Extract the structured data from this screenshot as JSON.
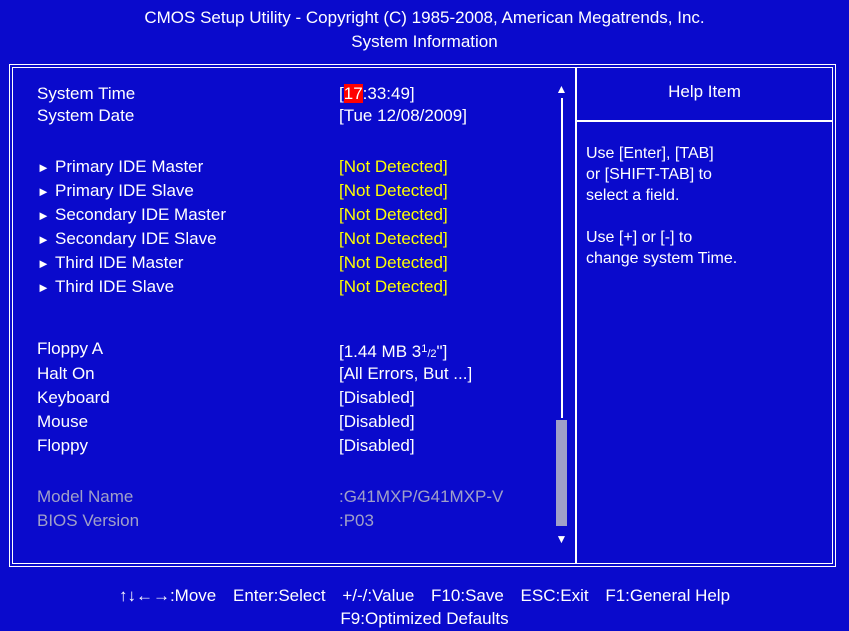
{
  "header": {
    "line1": "CMOS Setup Utility - Copyright (C) 1985-2008, American Megatrends, Inc.",
    "line2": "System Information"
  },
  "system_time": {
    "label": "System Time",
    "open": "[",
    "hour": "17",
    "rest": ":33:49]"
  },
  "system_date": {
    "label": "System Date",
    "value": "[Tue 12/08/2009]"
  },
  "ide": [
    {
      "label": "Primary IDE Master",
      "value": "[Not Detected]"
    },
    {
      "label": "Primary IDE Slave",
      "value": "[Not Detected]"
    },
    {
      "label": "Secondary IDE Master",
      "value": "[Not Detected]"
    },
    {
      "label": "Secondary IDE Slave",
      "value": "[Not Detected]"
    },
    {
      "label": "Third IDE Master",
      "value": "[Not Detected]"
    },
    {
      "label": "Third IDE Slave",
      "value": "[Not Detected]"
    }
  ],
  "devices": {
    "floppy_a": {
      "label": "Floppy A",
      "value_pre": "[1.44 MB 3",
      "value_sup": "1",
      "value_slash": "/",
      "value_sub": "2",
      "value_post": "\"]"
    },
    "halt_on": {
      "label": "Halt On",
      "value": "[All Errors, But ...]"
    },
    "keyboard": {
      "label": "Keyboard",
      "value": "[Disabled]"
    },
    "mouse": {
      "label": "Mouse",
      "value": "[Disabled]"
    },
    "floppy": {
      "label": "Floppy",
      "value": "[Disabled]"
    }
  },
  "info": {
    "model_label": "Model Name",
    "model_value": ":G41MXP/G41MXP-V",
    "bios_label": "BIOS Version",
    "bios_value": ":P03"
  },
  "help": {
    "title": "Help Item",
    "p1": "Use [Enter], [TAB]\nor [SHIFT-TAB] to\nselect a field.",
    "p2": "Use [+] or [-] to\nchange system Time."
  },
  "scrollbar": {
    "up_icon": "triangle-up",
    "down_icon": "triangle-down"
  },
  "footer": {
    "move": "↑↓←→:Move",
    "select": "Enter:Select",
    "value": "+/-/:Value",
    "save": "F10:Save",
    "exit": "ESC:Exit",
    "help": "F1:General Help",
    "defaults": "F9:Optimized Defaults"
  },
  "colors": {
    "background": "#0a0acc",
    "text": "#ffffff",
    "highlight_value": "#ffff00",
    "disabled_text": "#a0a0c8",
    "cursor": "#ff0000"
  }
}
